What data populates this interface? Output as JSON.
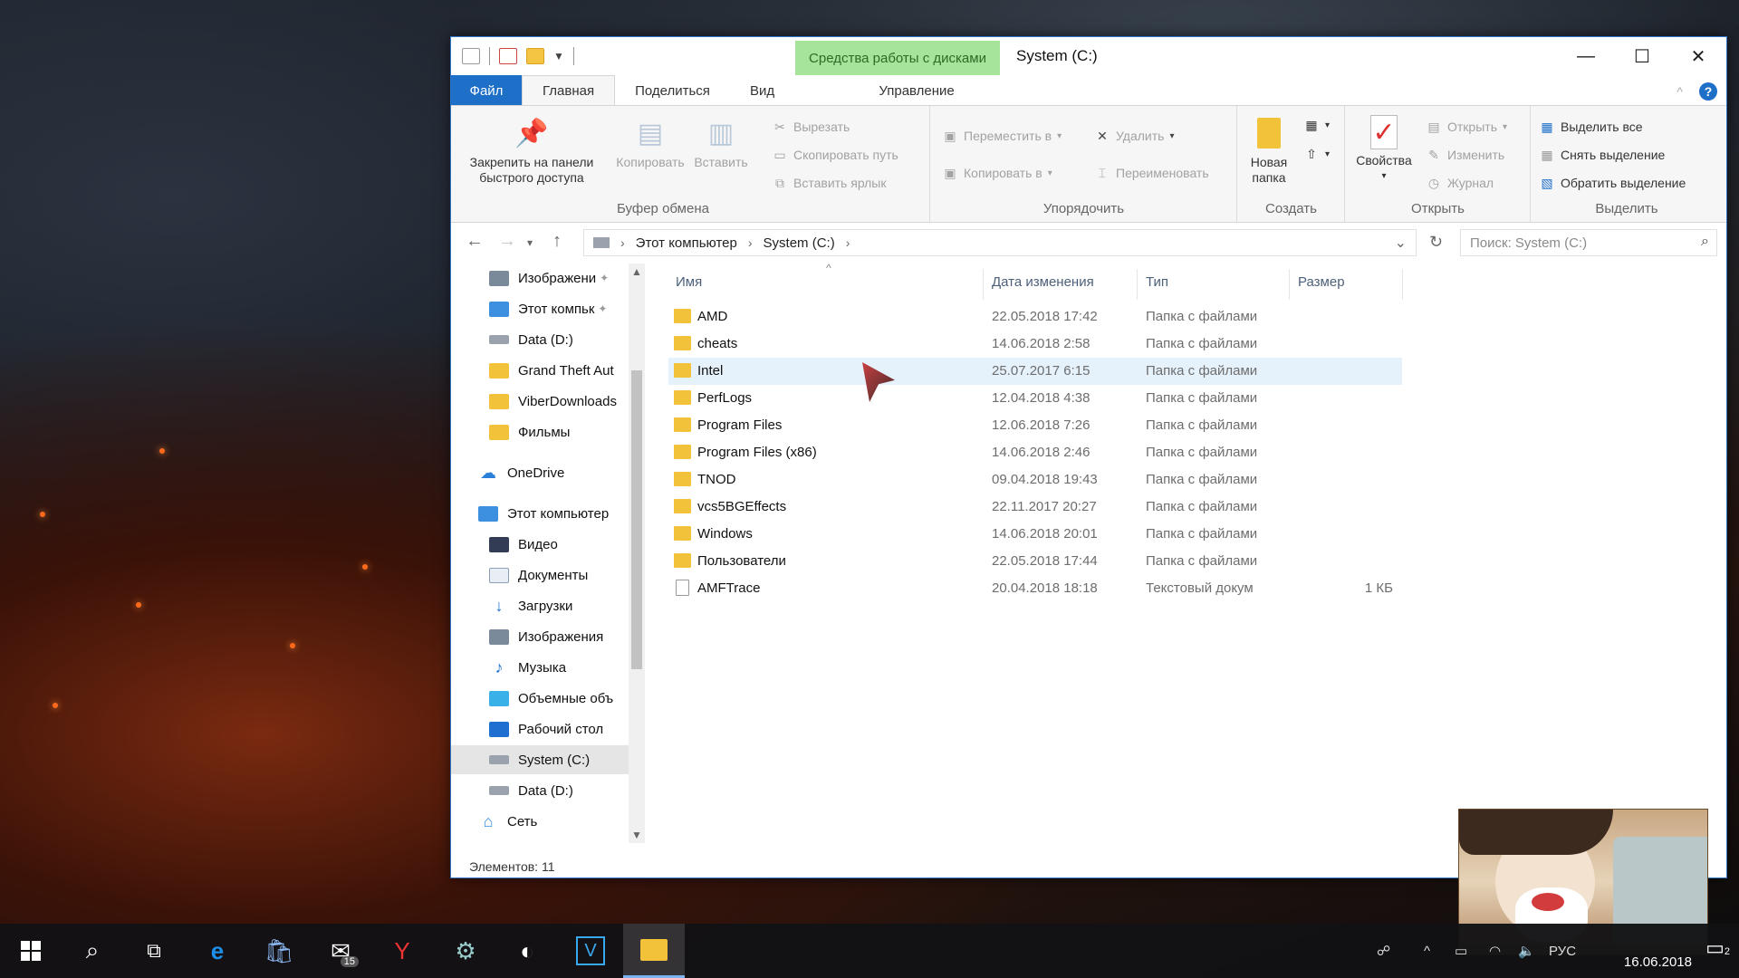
{
  "window": {
    "title": "System (C:)",
    "context_tab_label": "Средства работы с дисками",
    "controls": {
      "minimize": "—",
      "maximize": "☐",
      "close": "✕"
    }
  },
  "ribbon_tabs": {
    "file": "Файл",
    "home": "Главная",
    "share": "Поделиться",
    "view": "Вид",
    "manage": "Управление"
  },
  "ribbon": {
    "clipboard": {
      "label": "Буфер обмена",
      "pin": "Закрепить на панели быстрого доступа",
      "copy": "Копировать",
      "paste": "Вставить",
      "cut": "Вырезать",
      "copy_path": "Скопировать путь",
      "paste_shortcut": "Вставить ярлык"
    },
    "organize": {
      "label": "Упорядочить",
      "move_to": "Переместить в",
      "copy_to": "Копировать в",
      "delete": "Удалить",
      "rename": "Переименовать"
    },
    "create": {
      "label": "Создать",
      "new_folder": "Новая папка"
    },
    "open": {
      "label": "Открыть",
      "properties": "Свойства",
      "open": "Открыть",
      "edit": "Изменить",
      "history": "Журнал"
    },
    "select": {
      "label": "Выделить",
      "select_all": "Выделить все",
      "select_none": "Снять выделение",
      "invert": "Обратить выделение"
    }
  },
  "address": {
    "crumbs": [
      "Этот компьютер",
      "System (C:)"
    ],
    "search_placeholder": "Поиск: System (C:)"
  },
  "nav_pane": {
    "items": [
      {
        "label": "Изображени",
        "icon": "images-icon"
      },
      {
        "label": "Этот компьк",
        "icon": "pc-icon"
      },
      {
        "label": "Data (D:)",
        "icon": "drive-icon"
      },
      {
        "label": "Grand Theft Aut",
        "icon": "folder-icon"
      },
      {
        "label": "ViberDownloads",
        "icon": "folder-icon"
      },
      {
        "label": "Фильмы",
        "icon": "folder-icon"
      },
      {
        "label": "OneDrive",
        "icon": "cloud-icon"
      },
      {
        "label": "Этот компьютер",
        "icon": "pc-icon"
      },
      {
        "label": "Видео",
        "icon": "video-icon"
      },
      {
        "label": "Документы",
        "icon": "documents-icon"
      },
      {
        "label": "Загрузки",
        "icon": "downloads-icon"
      },
      {
        "label": "Изображения",
        "icon": "images-icon"
      },
      {
        "label": "Музыка",
        "icon": "music-icon"
      },
      {
        "label": "Объемные объ",
        "icon": "3d-objects-icon"
      },
      {
        "label": "Рабочий стол",
        "icon": "desktop-icon"
      },
      {
        "label": "System (C:)",
        "icon": "drive-icon",
        "selected": true
      },
      {
        "label": "Data (D:)",
        "icon": "drive-icon"
      },
      {
        "label": "Сеть",
        "icon": "network-icon"
      }
    ]
  },
  "columns": {
    "name": "Имя",
    "date": "Дата изменения",
    "type": "Тип",
    "size": "Размер"
  },
  "files": [
    {
      "name": "AMD",
      "date": "22.05.2018 17:42",
      "type": "Папка с файлами",
      "size": ""
    },
    {
      "name": "cheats",
      "date": "14.06.2018 2:58",
      "type": "Папка с файлами",
      "size": ""
    },
    {
      "name": "Intel",
      "date": "25.07.2017 6:15",
      "type": "Папка с файлами",
      "size": "",
      "selected": true
    },
    {
      "name": "PerfLogs",
      "date": "12.04.2018 4:38",
      "type": "Папка с файлами",
      "size": ""
    },
    {
      "name": "Program Files",
      "date": "12.06.2018 7:26",
      "type": "Папка с файлами",
      "size": ""
    },
    {
      "name": "Program Files (x86)",
      "date": "14.06.2018 2:46",
      "type": "Папка с файлами",
      "size": ""
    },
    {
      "name": "TNOD",
      "date": "09.04.2018 19:43",
      "type": "Папка с файлами",
      "size": ""
    },
    {
      "name": "vcs5BGEffects",
      "date": "22.11.2017 20:27",
      "type": "Папка с файлами",
      "size": ""
    },
    {
      "name": "Windows",
      "date": "14.06.2018 20:01",
      "type": "Папка с файлами",
      "size": ""
    },
    {
      "name": "Пользователи",
      "date": "22.05.2018 17:44",
      "type": "Папка с файлами",
      "size": ""
    },
    {
      "name": "AMFTrace",
      "date": "20.04.2018 18:18",
      "type": "Текстовый докум",
      "size": "1 КБ"
    }
  ],
  "status": {
    "items": "Элементов: 11"
  },
  "taskbar": {
    "mail_badge": "15",
    "tray_lang": "РУС",
    "date": "16.06.2018",
    "notif_count": "2"
  },
  "colors": {
    "accent": "#1e6fc8",
    "context_tab": "#a6e39b",
    "selection": "#e5f1fb"
  }
}
